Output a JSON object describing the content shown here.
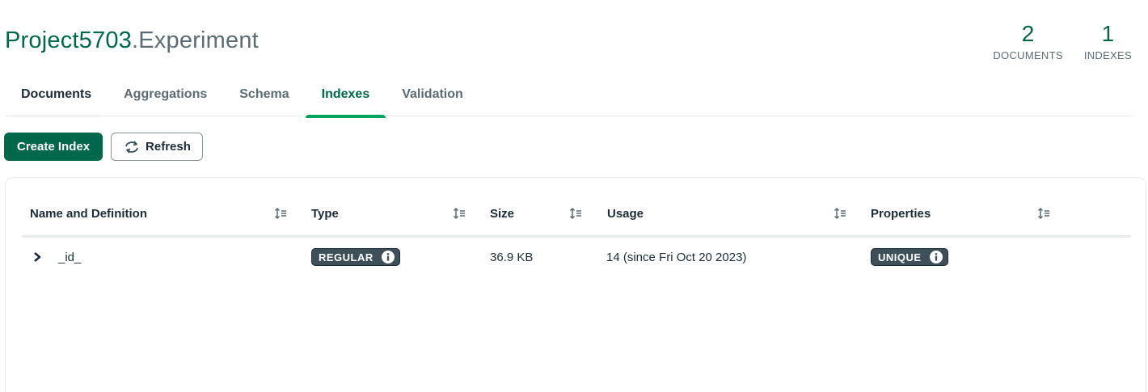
{
  "header": {
    "database": "Project5703",
    "separator": ".",
    "collection": "Experiment"
  },
  "stats": {
    "documents": {
      "value": "2",
      "label": "DOCUMENTS"
    },
    "indexes": {
      "value": "1",
      "label": "INDEXES"
    }
  },
  "tabs": [
    {
      "label": "Documents"
    },
    {
      "label": "Aggregations"
    },
    {
      "label": "Schema"
    },
    {
      "label": "Indexes",
      "active": true
    },
    {
      "label": "Validation"
    }
  ],
  "toolbar": {
    "create_label": "Create Index",
    "refresh_label": "Refresh"
  },
  "table": {
    "columns": [
      "Name and Definition",
      "Type",
      "Size",
      "Usage",
      "Properties"
    ],
    "rows": [
      {
        "name": "_id_",
        "type": "REGULAR",
        "size": "36.9 KB",
        "usage": "14 (since Fri Oct 20 2023)",
        "properties": "UNIQUE"
      }
    ]
  },
  "icons": {
    "sort": "sort-icon",
    "expand": "chevron-right-icon",
    "info": "info-icon",
    "refresh": "refresh-icon"
  },
  "colors": {
    "brand_green": "#00684a",
    "active_tab_underline": "#00a35c",
    "badge_bg": "#3d4f58",
    "muted_text": "#5c6c75"
  }
}
